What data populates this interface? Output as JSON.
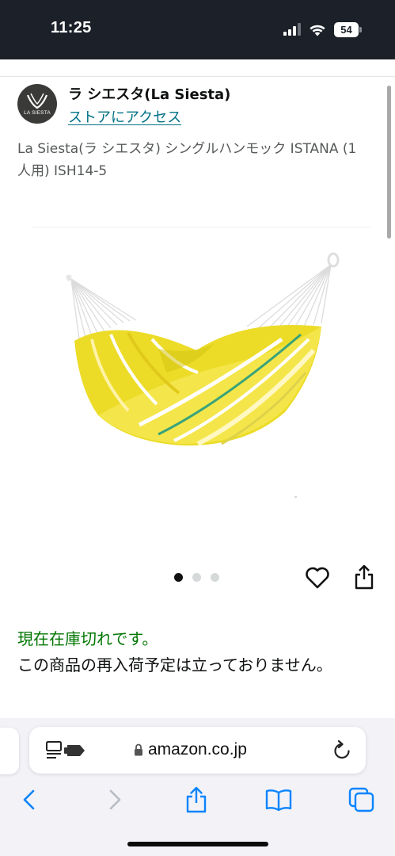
{
  "status_bar": {
    "time": "11:25",
    "battery": "54"
  },
  "brand": {
    "name": "ラ シエスタ(La Siesta)",
    "logo_text": "LA SIESTA",
    "store_link": "ストアにアクセス"
  },
  "product": {
    "title": "La Siesta(ラ シエスタ) シングルハンモック ISTANA (1人用) ISH14-5",
    "image_icon": "hammock-image",
    "carousel": {
      "total": 3,
      "active_index": 0
    }
  },
  "availability": {
    "status": "現在在庫切れです。",
    "note": "この商品の再入荷予定は立っておりません。"
  },
  "browser": {
    "url": "amazon.co.jp",
    "icons": {
      "reader": "reader-mode-icon",
      "lock": "lock-icon",
      "reload": "reload-icon",
      "back": "chevron-left-icon",
      "forward": "chevron-right-icon",
      "share": "share-icon",
      "bookmarks": "book-icon",
      "tabs": "tabs-icon"
    }
  },
  "colors": {
    "status_bar_bg": "#1c2129",
    "link": "#007185",
    "in_stock_green": "#007600",
    "ios_blue": "#0a84ff",
    "hammock_yellow": "#f2e31e"
  }
}
